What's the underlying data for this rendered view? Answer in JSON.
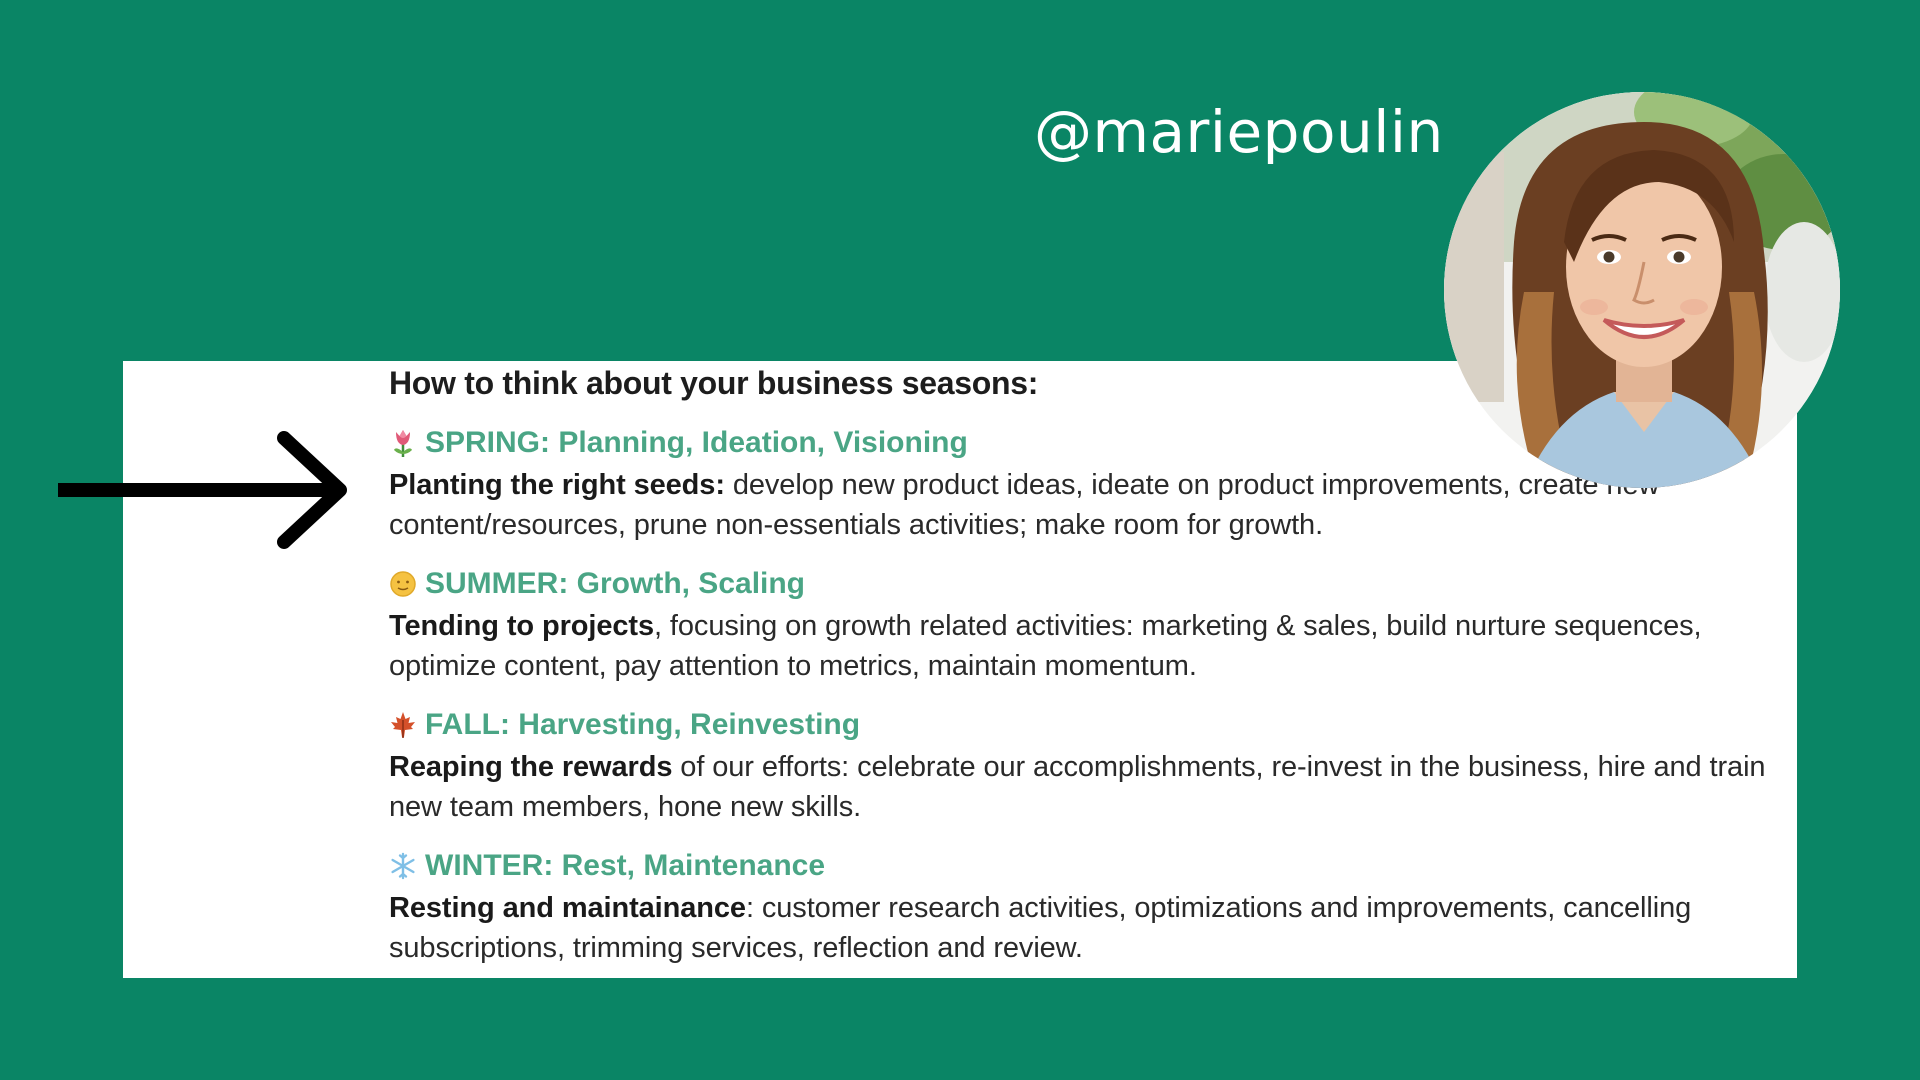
{
  "handle": "@mariepoulin",
  "heading": "How to think about your business seasons:",
  "seasons": [
    {
      "icon": "tulip-icon",
      "title": "SPRING: Planning, Ideation, Visioning",
      "bold": "Planting the right seeds:",
      "rest": " develop new product ideas, ideate on product improvements, create new content/resources, prune non-essentials activities; make room for growth."
    },
    {
      "icon": "sun-icon",
      "title": "SUMMER: Growth, Scaling",
      "bold": "Tending to projects",
      "rest": ", focusing on growth related activities: marketing & sales, build nurture sequences, optimize content, pay attention to metrics, maintain momentum."
    },
    {
      "icon": "maple-leaf-icon",
      "title": "FALL: Harvesting, Reinvesting",
      "bold": "Reaping the rewards",
      "rest": " of our efforts: celebrate our accomplishments, re-invest in the business, hire and train new team members, hone new skills."
    },
    {
      "icon": "snowflake-icon",
      "title": "WINTER: Rest, Maintenance",
      "bold": "Resting and maintainance",
      "rest": ": customer research activities, optimizations and improvements, cancelling subscriptions, trimming services, reflection and review."
    }
  ],
  "colors": {
    "background": "#0a8565",
    "accent": "#4aa585",
    "panel": "#ffffff"
  }
}
